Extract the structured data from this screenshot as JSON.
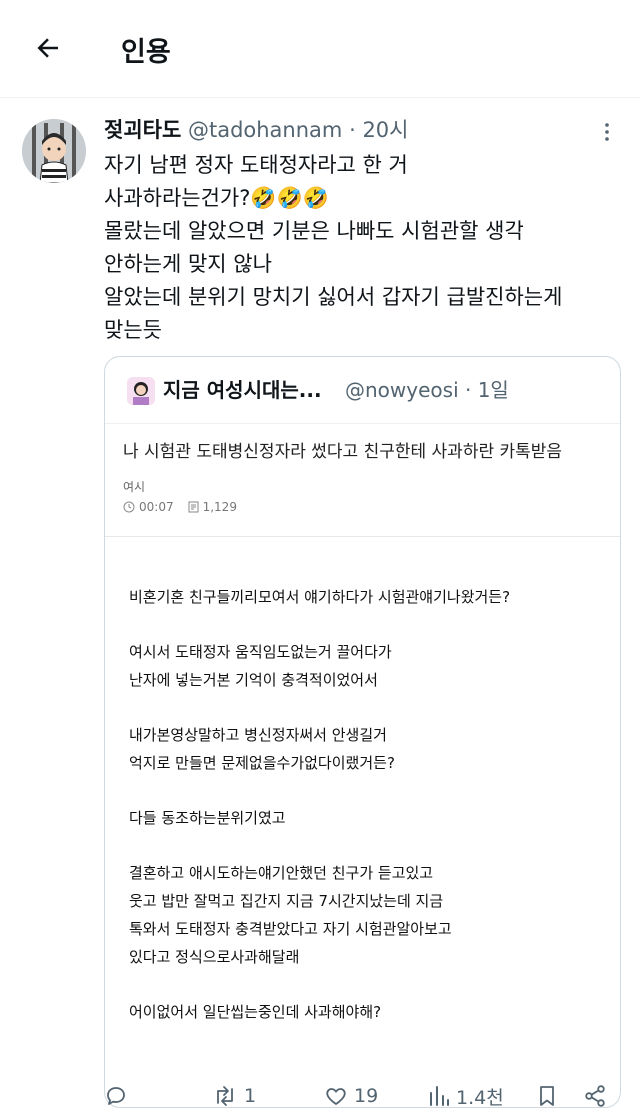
{
  "header": {
    "title": "인용",
    "back_icon": "arrow-left-icon"
  },
  "tweet": {
    "author_name": "젖괴타도",
    "author_handle": "@tadohannam",
    "separator": "·",
    "time": "20시",
    "lines": [
      "자기 남편 정자 도태정자라고 한 거",
      "사과하라는건가?🤣🤣🤣",
      "몰랐는데 알았으면 기분은 나빠도 시험관할 생각",
      "안하는게 맞지 않나",
      "알았는데 분위기 망치기 싫어서 갑자기 급발진하는게",
      "맞는듯"
    ]
  },
  "quote": {
    "author_name": "지금 여성시대는...",
    "author_handle": "@nowyeosi",
    "separator": "·",
    "time": "1일",
    "card": {
      "title": "나 시험관 도태병신정자라 썼다고 친구한테 사과하란 카톡받음",
      "category": "여시",
      "time": "00:07",
      "views": "1,129",
      "paragraphs": [
        [
          "비혼기혼 친구들끼리모여서 얘기하다가 시험관얘기나왔거든?"
        ],
        [
          "여시서 도태정자 움직임도없는거 끌어다가",
          "난자에 넣는거본 기억이 충격적이었어서"
        ],
        [
          "내가본영상말하고 병신정자써서 안생길거",
          "억지로 만들면 문제없을수가없다이랬거든?"
        ],
        [
          "다들 동조하는분위기였고"
        ],
        [
          "결혼하고 애시도하는얘기안했던 친구가 듣고있고",
          "웃고 밥만 잘먹고 집간지 지금 7시간지났는데 지금",
          "톡와서 도태정자 충격받았다고 자기 시험관알아보고",
          "있다고 정식으로사과해달래"
        ],
        [
          "어이없어서 일단씹는중인데 사과해야해?"
        ]
      ]
    }
  },
  "actions": {
    "reply_count": "",
    "retweet_count": "1",
    "like_count": "19",
    "view_count": "1.4천"
  },
  "colors": {
    "text": "#0f1419",
    "muted": "#536471",
    "border": "#cfd9de"
  }
}
